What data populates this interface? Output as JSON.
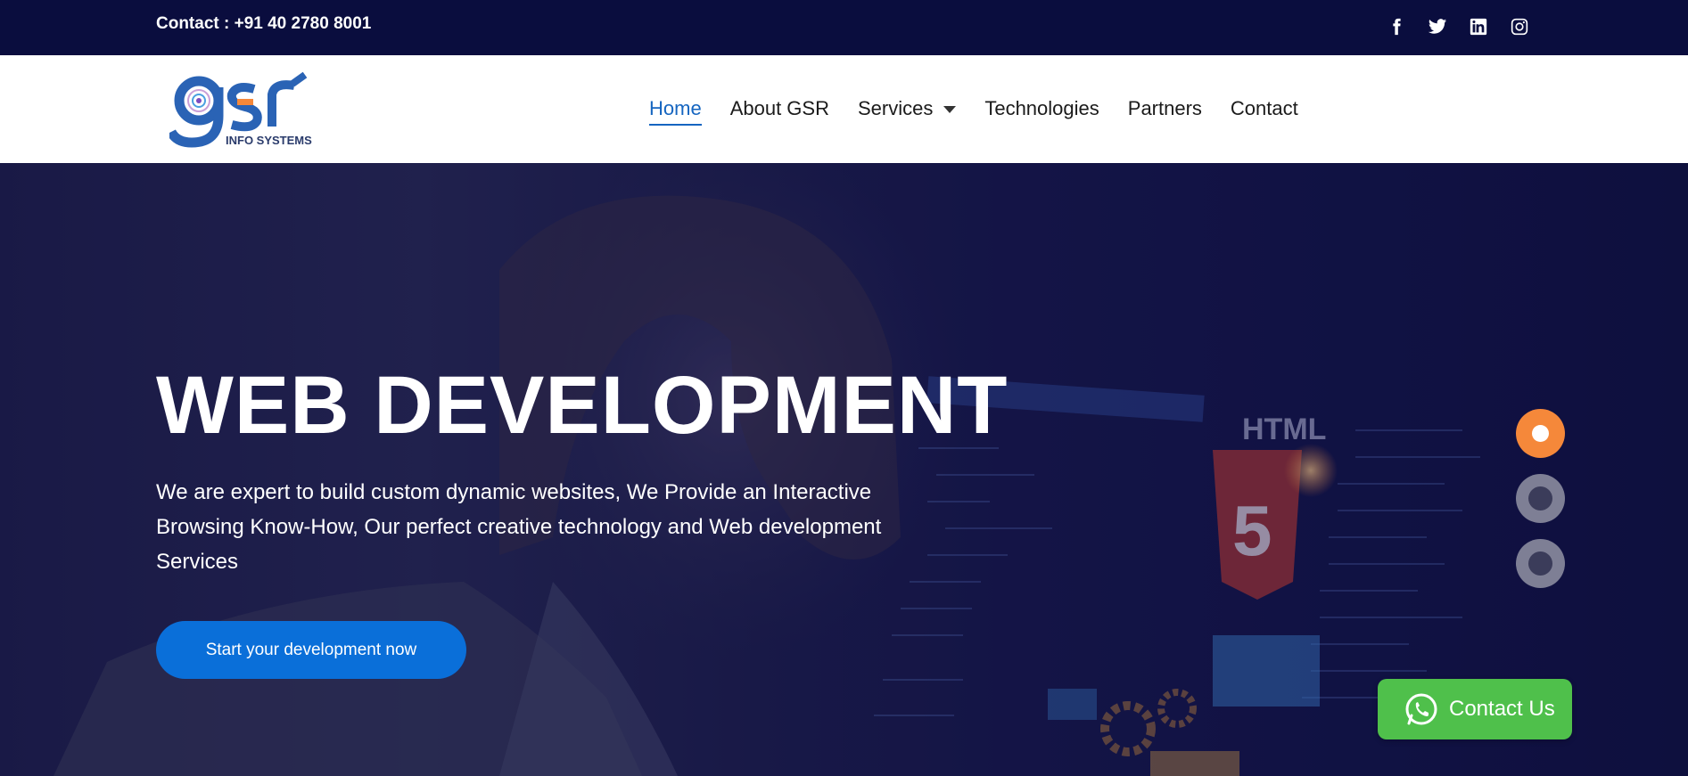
{
  "topbar": {
    "contact": "Contact : +91 40 2780 8001",
    "socials": [
      "facebook-icon",
      "twitter-icon",
      "linkedin-icon",
      "instagram-icon"
    ]
  },
  "header": {
    "logo_text": "gsr",
    "logo_sub": "INFO SYSTEMS",
    "nav": [
      {
        "label": "Home",
        "active": true
      },
      {
        "label": "About GSR"
      },
      {
        "label": "Services",
        "dropdown": true
      },
      {
        "label": "Technologies"
      },
      {
        "label": "Partners"
      },
      {
        "label": "Contact"
      }
    ]
  },
  "hero": {
    "title": "WEB DEVELOPMENT",
    "text": "We are expert to build custom dynamic websites, We Provide an Interactive Browsing Know-How, Our perfect creative technology and Web development Services",
    "cta": "Start your development now",
    "html_badge": "HTML",
    "html_num": "5",
    "slides": 3,
    "active_slide": 0
  },
  "whatsapp": {
    "label": "Contact Us"
  },
  "colors": {
    "topbar": "#0a0d3e",
    "accent": "#0a6fd9",
    "orange": "#f5883a",
    "whatsapp": "#4fc04b",
    "logo_blue": "#2a63b5"
  }
}
